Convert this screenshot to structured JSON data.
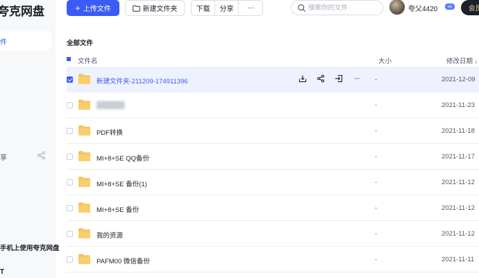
{
  "app": {
    "logo": "夸克网盘"
  },
  "sidebar": {
    "active_item": "件",
    "share_item": "享",
    "promo": "手机上使用夸克网盘",
    "bottom": "T"
  },
  "toolbar": {
    "upload_label": "上传文件",
    "new_folder_label": "新建文件夹",
    "download_label": "下载",
    "share_label": "分享",
    "more_label": "···"
  },
  "search": {
    "placeholder": "搜索你的文件"
  },
  "user": {
    "name": "夸父4420",
    "vip_badge": "vip",
    "member_button": "会员"
  },
  "breadcrumb": "全部文件",
  "table": {
    "columns": {
      "name": "文件名",
      "size": "大小",
      "date": "修改日期 ↓"
    },
    "rows": [
      {
        "name": "新建文件夹-211209-174911396",
        "size": "-",
        "date": "2021-12-09",
        "selected": true
      },
      {
        "name": "██████",
        "size": "-",
        "date": "2021-11-23",
        "selected": false,
        "blurred": true
      },
      {
        "name": "PDF转换",
        "size": "-",
        "date": "2021-11-18",
        "selected": false
      },
      {
        "name": "MI+8+SE QQ备份",
        "size": "-",
        "date": "2021-11-17",
        "selected": false
      },
      {
        "name": "MI+8+SE 备份(1)",
        "size": "-",
        "date": "2021-11-12",
        "selected": false
      },
      {
        "name": "MI+8+SE 备份",
        "size": "-",
        "date": "2021-11-12",
        "selected": false
      },
      {
        "name": "我的资源",
        "size": "-",
        "date": "2021-11-12",
        "selected": false
      },
      {
        "name": "PAFM00 微信备份",
        "size": "-",
        "date": "2021-11-11",
        "selected": false
      }
    ]
  },
  "colors": {
    "accent": "#3a5bf4",
    "folder": "#f5c45e",
    "selected_row": "#eef1fe"
  },
  "icons": [
    "upload-plus-icon",
    "folder-icon",
    "search-icon",
    "download-icon",
    "share-icon",
    "move-icon",
    "more-icon"
  ]
}
